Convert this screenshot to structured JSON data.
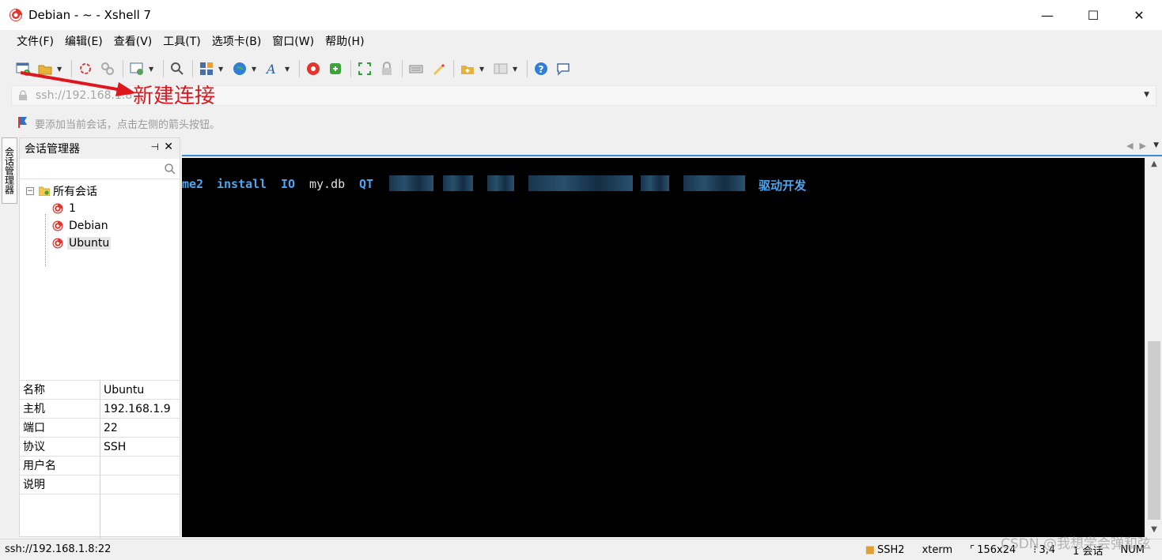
{
  "window": {
    "title": "Debian - ~ - Xshell 7",
    "minimize": "—",
    "maximize": "☐",
    "close": "✕"
  },
  "menu": [
    "文件(F)",
    "编辑(E)",
    "查看(V)",
    "工具(T)",
    "选项卡(B)",
    "窗口(W)",
    "帮助(H)"
  ],
  "toolbar": {
    "icons": [
      "new-session-icon",
      "open-folder-icon",
      "reconnect-icon",
      "disconnect-icon",
      "properties-icon",
      "find-icon",
      "layout-icon",
      "globe-icon",
      "font-icon",
      "xshell-icon",
      "xftp-icon",
      "fullscreen-icon",
      "lock-icon",
      "keyboard-icon",
      "highlight-icon",
      "folder-add-icon",
      "panel-icon",
      "help-icon",
      "chat-icon"
    ]
  },
  "address": {
    "value": "ssh://192.168.1.8"
  },
  "hint": {
    "text": "要添加当前会话，点击左侧的箭头按钮。"
  },
  "annotation": {
    "text": "新建连接",
    "color": "#e0161e"
  },
  "side_tab": {
    "label": "会话管理器"
  },
  "session_manager": {
    "title": "会话管理器",
    "pin": "⊣",
    "close": "✕",
    "root": {
      "expander": "−",
      "label": "所有会话"
    },
    "sessions": [
      {
        "label": "1"
      },
      {
        "label": "Debian"
      },
      {
        "label": "Ubuntu"
      }
    ],
    "properties": [
      {
        "key": "名称",
        "value": "Ubuntu"
      },
      {
        "key": "主机",
        "value": "192.168.1.9"
      },
      {
        "key": "端口",
        "value": "22"
      },
      {
        "key": "协议",
        "value": "SSH"
      },
      {
        "key": "用户名",
        "value": ""
      },
      {
        "key": "说明",
        "value": ""
      }
    ]
  },
  "terminal": {
    "words": [
      {
        "text": "me2",
        "style": "dir"
      },
      {
        "text": "install",
        "style": "dir"
      },
      {
        "text": "IO",
        "style": "dir"
      },
      {
        "text": "my.db",
        "style": "file"
      },
      {
        "text": "QT",
        "style": "dir"
      },
      {
        "text": "驱动开发",
        "style": "dir"
      }
    ],
    "colors": {
      "dir": "#4ea6f0",
      "file": "#e0e0e0",
      "background": "#000000"
    }
  },
  "status": {
    "connection": "ssh://192.168.1.8:22",
    "protocol": "SSH2",
    "term": "xterm",
    "size": "156x24",
    "cursor": "3,4",
    "sessions": "1 会话",
    "numlock": "NUM"
  },
  "watermark": "CSDN @我想学会弹和弦"
}
